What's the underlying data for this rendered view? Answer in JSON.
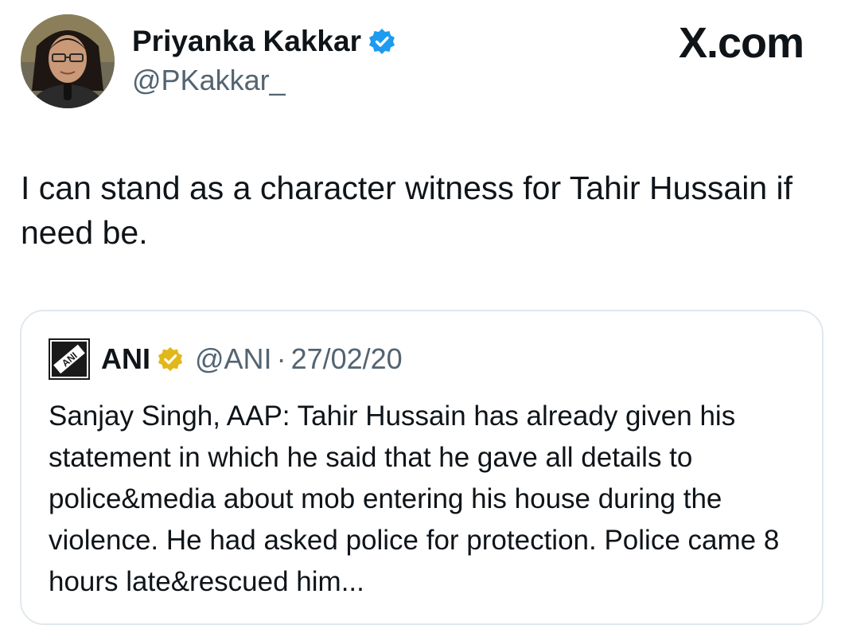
{
  "tweet": {
    "author": {
      "display_name": "Priyanka Kakkar",
      "handle": "@PKakkar_",
      "verified_badge": "blue-verified-icon",
      "accent": "#1d9bf0"
    },
    "brand": "X.com",
    "text": "I can stand as a character witness for Tahir Hussain if need be."
  },
  "quoted": {
    "author": {
      "display_name": "ANI",
      "handle": "@ANI",
      "verified_badge": "gold-verified-icon",
      "accent": "#e2b719",
      "logo_text": "ANI"
    },
    "separator": "·",
    "date": "27/02/20",
    "text": "Sanjay Singh, AAP: Tahir Hussain has already given his statement in which he said that he gave all details to police&media about mob entering his house during the violence. He had asked police for protection. Police came 8 hours late&rescued him..."
  }
}
